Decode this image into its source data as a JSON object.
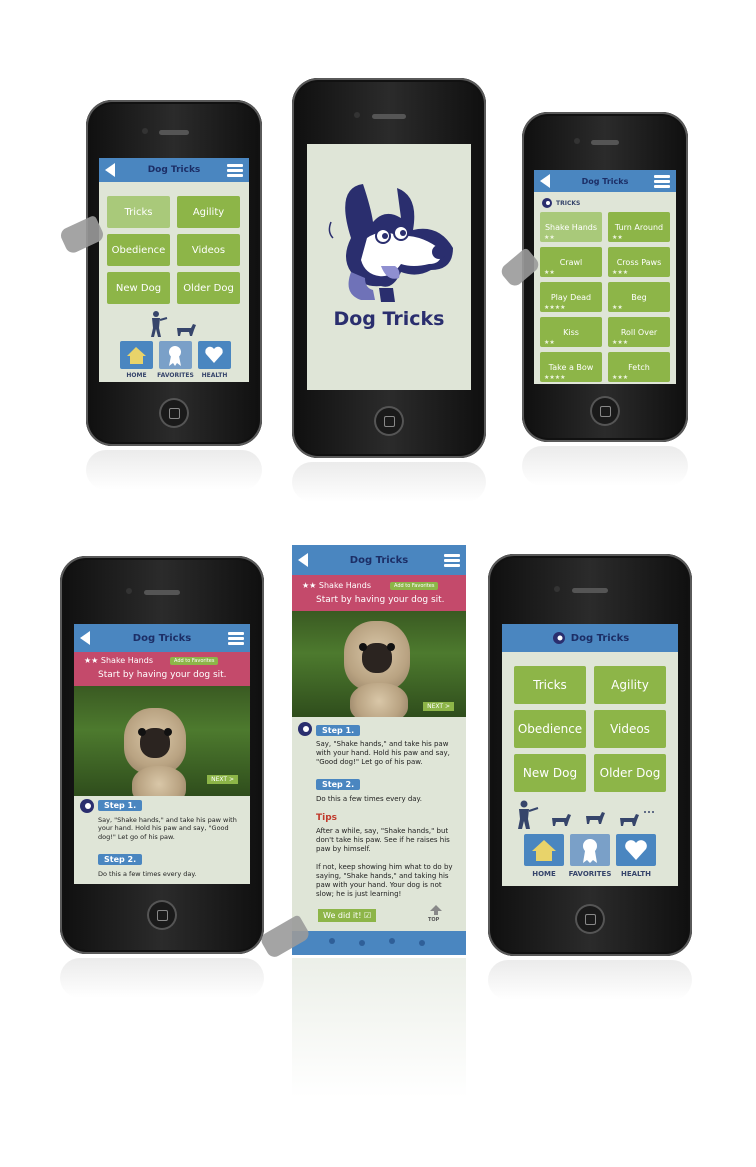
{
  "app_title": "Dog Tricks",
  "splash": {
    "logo_text": "Dog Tricks"
  },
  "menu": {
    "items": [
      "Tricks",
      "Agility",
      "Obedience",
      "Videos",
      "New Dog",
      "Older Dog"
    ]
  },
  "tabs": {
    "home": "HOME",
    "favorites": "FAVORITES",
    "health": "HEALTH"
  },
  "tricks": {
    "section_label": "TRICKS",
    "items": [
      {
        "label": "Shake Hands",
        "stars": "★★"
      },
      {
        "label": "Turn Around",
        "stars": "★★"
      },
      {
        "label": "Crawl",
        "stars": "★★"
      },
      {
        "label": "Cross Paws",
        "stars": "★★★"
      },
      {
        "label": "Play Dead",
        "stars": "★★★★"
      },
      {
        "label": "Beg",
        "stars": "★★"
      },
      {
        "label": "Kiss",
        "stars": "★★"
      },
      {
        "label": "Roll Over",
        "stars": "★★★"
      },
      {
        "label": "Take a Bow",
        "stars": "★★★★"
      },
      {
        "label": "Fetch",
        "stars": "★★★"
      }
    ]
  },
  "detail": {
    "title": "★★ Shake Hands",
    "add_favorites": "Add to Favorites",
    "subtitle": "Start by having your dog sit.",
    "next": "NEXT >",
    "step1_label": "Step 1.",
    "step1_text": "Say, \"Shake hands,\" and take his paw with your hand. Hold his paw and say, \"Good dog!\" Let go of his paw.",
    "step2_label": "Step 2.",
    "step2_text": "Do this a few times every day.",
    "tips_label": "Tips",
    "tips_text1": "After a while, say, \"Shake hands,\" but don't take his paw. See if he raises his paw by himself.",
    "tips_text2": "If not, keep showing him what to do by saying, \"Shake hands,\" and taking his paw with your hand. Your dog is not slow; he is just learning!",
    "we_did_it": "We did it! ☑",
    "top": "TOP"
  },
  "colors": {
    "bar_blue": "#4a86c0",
    "button_green": "#8db548",
    "screen_bg": "#dfe5d7",
    "pink": "#c44a6b",
    "navy": "#1c2e66"
  }
}
